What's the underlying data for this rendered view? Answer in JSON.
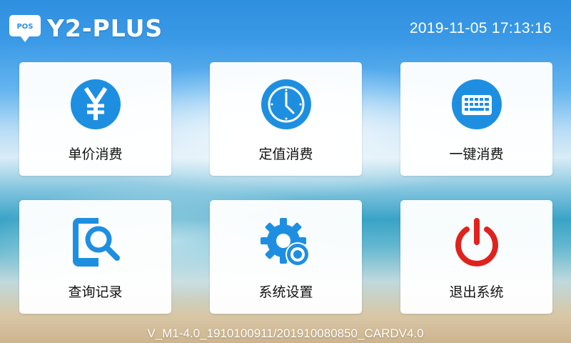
{
  "header": {
    "logo_icon": "pos-chat-bubble-icon",
    "logo_text": "POS",
    "brand": "Y2-PLUS",
    "datetime": "2019-11-05 17:13:16"
  },
  "tiles": [
    {
      "label": "单价消费",
      "icon": "yen-icon"
    },
    {
      "label": "定值消费",
      "icon": "clock-icon"
    },
    {
      "label": "一键消费",
      "icon": "keyboard-icon"
    },
    {
      "label": "查询记录",
      "icon": "search-record-icon"
    },
    {
      "label": "系统设置",
      "icon": "gear-icon"
    },
    {
      "label": "退出系统",
      "icon": "power-icon"
    }
  ],
  "footer": {
    "version": "V_M1-4.0_1910100911/201910080850_CARDV4.0"
  },
  "colors": {
    "accent": "#1e8fe0",
    "power": "#e0221d",
    "tile_bg": "#ffffff"
  }
}
